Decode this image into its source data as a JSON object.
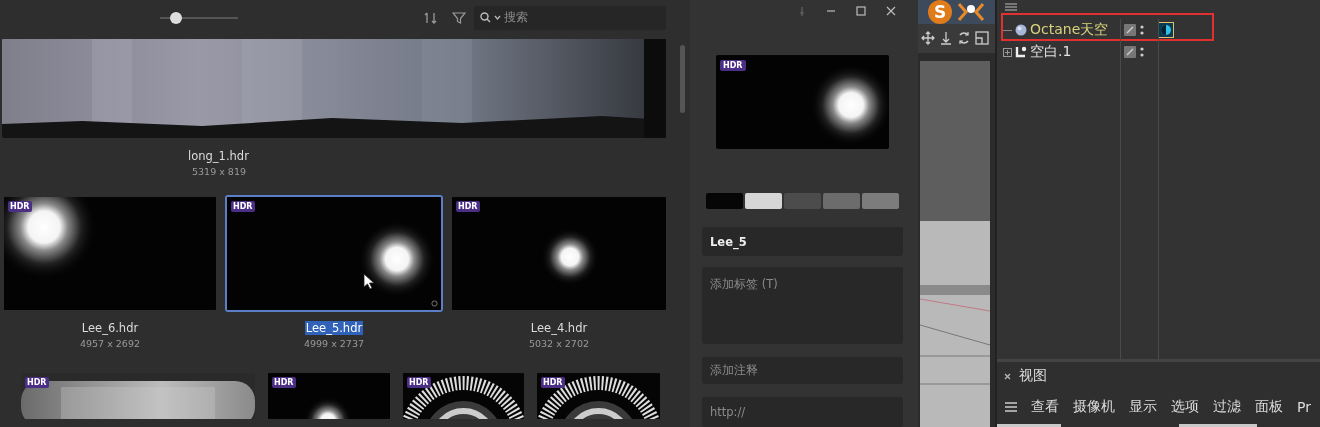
{
  "asset_browser": {
    "zoom_slider": {
      "level": 0.2
    },
    "search": {
      "placeholder": "搜索"
    },
    "first_row": [
      {
        "name": "long_1.hdr",
        "size": "5319 x 819",
        "selected": false
      }
    ],
    "second_row": [
      {
        "name": "Lee_6.hdr",
        "size": "4957 x 2692",
        "badge": "HDR",
        "selected": false
      },
      {
        "name": "Lee_5.hdr",
        "size": "4999 x 2737",
        "badge": "HDR",
        "selected": true
      },
      {
        "name": "Lee_4.hdr",
        "size": "5032 x 2702",
        "badge": "HDR",
        "selected": false
      }
    ],
    "third_row": [
      {
        "badge": "HDR",
        "selected": false
      },
      {
        "badge": "HDR",
        "selected": false
      },
      {
        "badge": "HDR",
        "selected": false
      },
      {
        "badge": "HDR",
        "selected": false
      }
    ]
  },
  "detail_panel": {
    "preview": {
      "badge": "HDR"
    },
    "swatches": [
      {
        "color": "#060606"
      },
      {
        "color": "#d6d6d6"
      },
      {
        "color": "#4c4c4c"
      },
      {
        "color": "#6c6c6c"
      },
      {
        "color": "#7c7c7c"
      }
    ],
    "name_field": {
      "value": "Lee_5"
    },
    "tags_field": {
      "placeholder": "添加标签 (T)"
    },
    "notes_field": {
      "placeholder": "添加注释"
    },
    "url_field": {
      "placeholder": "http://"
    }
  },
  "app_logo": {
    "letter": "S"
  },
  "object_manager": {
    "objects": [
      {
        "name": "Octane天空",
        "kind": "sky",
        "selected": true,
        "marked": true,
        "collapsed": false
      },
      {
        "name": "空白.1",
        "kind": "null",
        "selected": false,
        "marked": false,
        "collapsed": true
      }
    ]
  },
  "viewport_panel": {
    "title": "视图",
    "menu": [
      "查看",
      "摄像机",
      "显示",
      "选项",
      "过滤",
      "面板",
      "Pr"
    ]
  }
}
